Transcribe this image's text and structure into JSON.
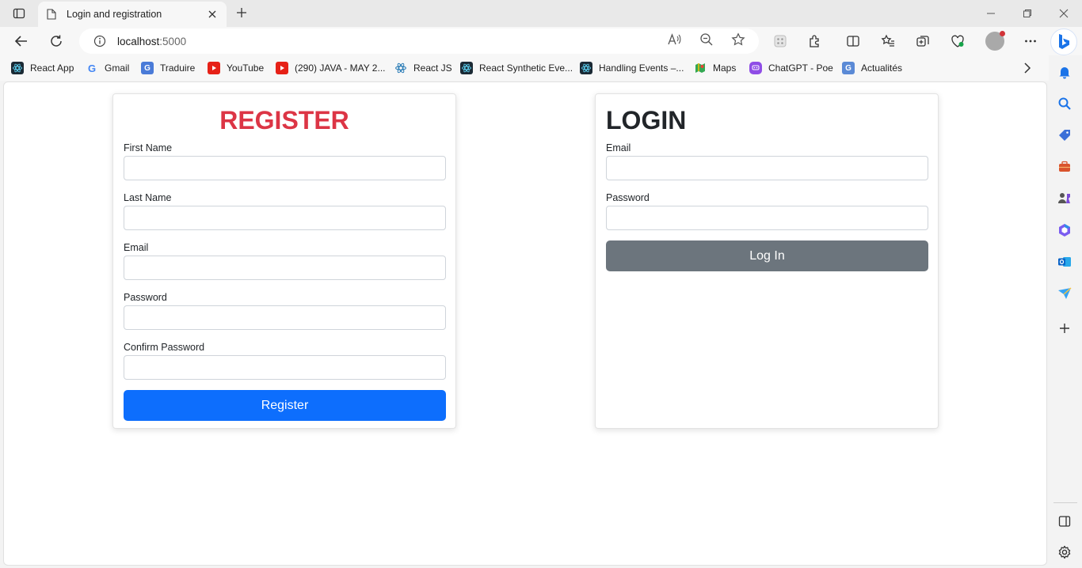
{
  "browser": {
    "tab_title": "Login and registration",
    "address": {
      "host": "localhost",
      "port": ":5000"
    }
  },
  "bookmarks": [
    {
      "label": "React App",
      "icon": "react-icon",
      "color": "#1b2a35"
    },
    {
      "label": "Gmail",
      "icon": "google-icon",
      "color": "#ffffff"
    },
    {
      "label": "Traduire",
      "icon": "translate-icon",
      "color": "#4a7bd8"
    },
    {
      "label": "YouTube",
      "icon": "youtube-icon",
      "color": "#e62117"
    },
    {
      "label": "(290) JAVA - MAY 2...",
      "icon": "youtube-icon",
      "color": "#e62117"
    },
    {
      "label": "React JS",
      "icon": "react-icon",
      "color": "#ffffff"
    },
    {
      "label": "React Synthetic Eve...",
      "icon": "react-icon",
      "color": "#1b2a35"
    },
    {
      "label": "Handling Events –...",
      "icon": "react-icon",
      "color": "#1b2a35"
    },
    {
      "label": "Maps",
      "icon": "maps-icon",
      "color": "#34a853"
    },
    {
      "label": "ChatGPT - Poe",
      "icon": "poe-icon",
      "color": "#8f4de6"
    },
    {
      "label": "Actualités",
      "icon": "news-icon",
      "color": "#5b8ad6"
    }
  ],
  "register": {
    "title": "REGISTER",
    "title_color": "#dc3545",
    "first_name_label": "First Name",
    "last_name_label": "Last Name",
    "email_label": "Email",
    "password_label": "Password",
    "confirm_password_label": "Confirm Password",
    "button_label": "Register",
    "button_color": "#0d6efd"
  },
  "login": {
    "title": "LOGIN",
    "email_label": "Email",
    "password_label": "Password",
    "button_label": "Log In",
    "button_color": "#6c757d"
  }
}
